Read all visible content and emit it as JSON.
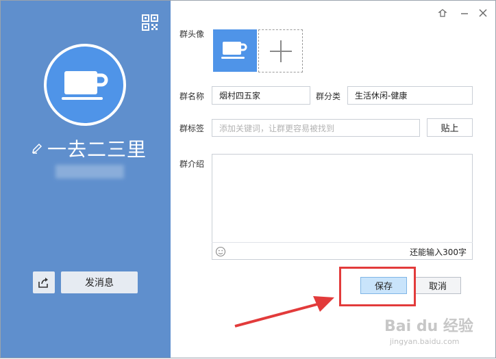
{
  "sidebar": {
    "group_name": "一去二三里",
    "send_message_label": "发消息"
  },
  "form": {
    "avatar_label": "群头像",
    "name_label": "群名称",
    "name_value": "烟村四五家",
    "category_label": "群分类",
    "category_value": "生活休闲-健康",
    "tag_label": "群标签",
    "tag_placeholder": "添加关键词，让群更容易被找到",
    "paste_label": "贴上",
    "intro_label": "群介绍",
    "counter_text": "还能输入300字"
  },
  "actions": {
    "save_label": "保存",
    "cancel_label": "取消"
  },
  "watermark": {
    "brand": "Bai du 经验",
    "url": "jingyan.baidu.com"
  },
  "colors": {
    "sidebar_bg": "#5f8fcd",
    "avatar_blue": "#4f94e8",
    "highlight_red": "#e23b3b"
  }
}
